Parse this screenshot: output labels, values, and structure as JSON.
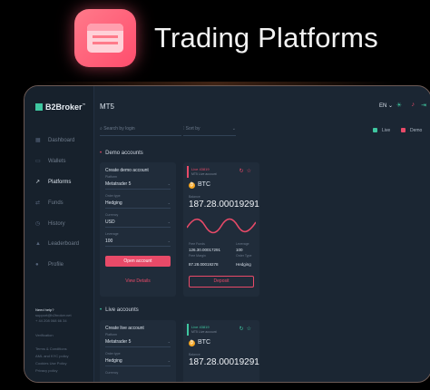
{
  "header": {
    "title": "Trading Platforms",
    "icon": "trading-window-icon"
  },
  "app": {
    "logo": "B2Broker",
    "logo_tm": "™",
    "page_title": "MT5",
    "language": "EN",
    "nav": [
      {
        "label": "Dashboard",
        "icon": "grid-icon"
      },
      {
        "label": "Wallets",
        "icon": "wallet-icon"
      },
      {
        "label": "Platforms",
        "icon": "chart-icon",
        "active": true
      },
      {
        "label": "Funds",
        "icon": "funds-icon"
      },
      {
        "label": "History",
        "icon": "history-icon"
      },
      {
        "label": "Leaderboard",
        "icon": "leaderboard-icon"
      },
      {
        "label": "Profile",
        "icon": "profile-icon"
      }
    ],
    "help": {
      "title": "Need help?",
      "email": "support@b2broker.net",
      "phone": "+ 44 208 068 66 34",
      "verification": "Verification",
      "links": [
        "Terms & Conditions",
        "AML and KYC policy",
        "Cookies Use Policy",
        "Privacy policy"
      ]
    },
    "toolbar": {
      "search_placeholder": "Search by login",
      "sort_placeholder": "Sort by",
      "live_label": "Live",
      "demo_label": "Demo"
    },
    "sections": {
      "demo": "Demo accounts",
      "live": "Live accounts"
    },
    "demo_form": {
      "title": "Create demo account",
      "platform_label": "Platform",
      "platform_value": "Metatrader 5",
      "order_label": "Order type",
      "order_value": "Hedging",
      "currency_label": "Currency",
      "currency_value": "USD",
      "leverage_label": "Leverage",
      "leverage_value": "100",
      "open_button": "Open account",
      "view_details": "View Details"
    },
    "live_form": {
      "title": "Create live account",
      "platform_label": "Platform",
      "platform_value": "Metatrader 5",
      "order_label": "Order type",
      "order_value": "Hedging",
      "currency_label": "Currency"
    },
    "demo_card": {
      "tag": "Live 43819",
      "tag_sub": "MT5 Live account",
      "asset": "BTC",
      "balance_label": "Balance",
      "balance": "187.28.00019291",
      "free_funds_label": "Free Funds",
      "free_funds": "126.30.00017291",
      "leverage_label": "Leverage",
      "leverage": "100",
      "free_margin_label": "Free Margin",
      "free_margin": "87.28.00019278",
      "order_type_label": "Order Type",
      "order_type": "Hedging",
      "deposit_button": "Deposit"
    },
    "live_card": {
      "tag": "Live 43819",
      "tag_sub": "MT5 Live account",
      "asset": "BTC",
      "balance_label": "Balance",
      "balance": "187.28.00019291"
    },
    "colors": {
      "accent": "#e84a68",
      "green": "#3fc7a0",
      "bg": "#1b2633"
    }
  }
}
